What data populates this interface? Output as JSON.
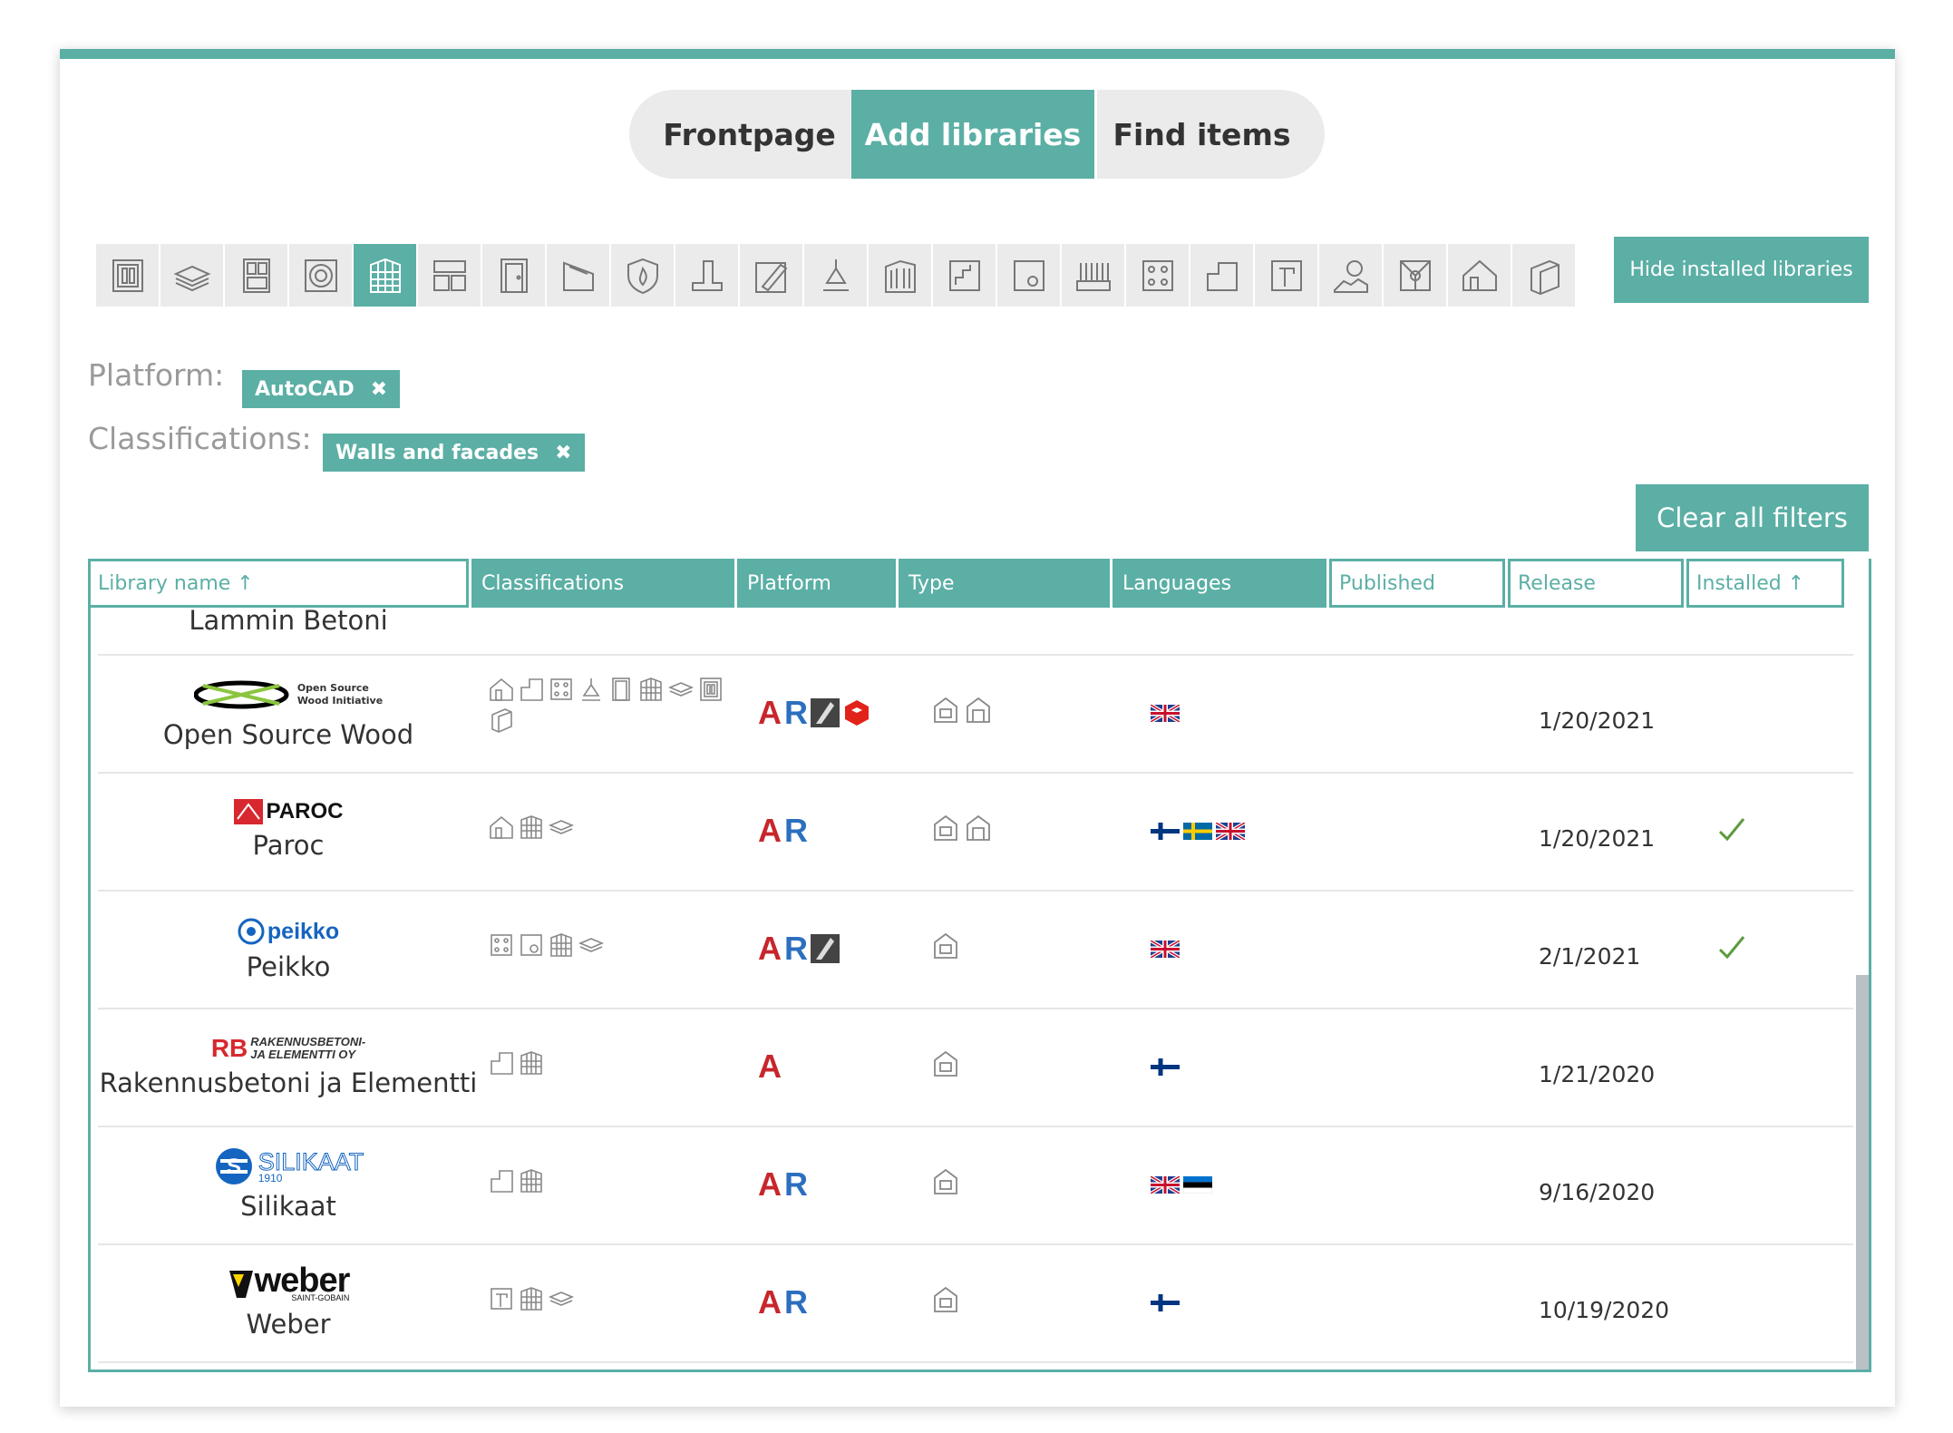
{
  "nav": {
    "tabs": [
      {
        "label": "Frontpage",
        "active": false
      },
      {
        "label": "Add libraries",
        "active": true
      },
      {
        "label": "Find items",
        "active": false
      }
    ]
  },
  "categories": [
    "panel-icon",
    "layers-icon",
    "cabinet-icon",
    "disc-icon",
    "grid-wall-icon",
    "modules-icon",
    "door-icon",
    "roof-icon",
    "fire-icon",
    "chimney-icon",
    "pencil-icon",
    "lamp-icon",
    "facade-icon",
    "stair-icon",
    "socket-icon",
    "fence-icon",
    "dots-panel-icon",
    "step-icon",
    "faucet-icon",
    "landscape-icon",
    "vent-icon",
    "house-icon",
    "sheet-icon"
  ],
  "active_category": 4,
  "buttons": {
    "hide_installed": "Hide installed libraries",
    "clear_filters": "Clear all filters"
  },
  "filters": {
    "platform_label": "Platform:",
    "platform_chip": "AutoCAD",
    "classifications_label": "Classifications:",
    "classifications_chip": "Walls and facades",
    "remove_glyph": "✖"
  },
  "table": {
    "headers": {
      "library_name": "Library name ↑",
      "classifications": "Classifications",
      "platform": "Platform",
      "type": "Type",
      "languages": "Languages",
      "published": "Published",
      "release": "Release",
      "installed": "Installed ↑"
    },
    "rows": [
      {
        "name": "Lammin Betoni",
        "logo": "",
        "release": "",
        "installed": false
      },
      {
        "name": "Open Source Wood",
        "logo": "Open Source Wood Initiative",
        "release": "1/20/2021",
        "installed": false
      },
      {
        "name": "Paroc",
        "logo": "PAROC",
        "release": "1/20/2021",
        "installed": true
      },
      {
        "name": "Peikko",
        "logo": "peikko",
        "release": "2/1/2021",
        "installed": true
      },
      {
        "name": "Rakennusbetoni ja Elementti",
        "logo": "RAKENNUSBETONI- JA ELEMENTTI OY",
        "release": "1/21/2020",
        "installed": false
      },
      {
        "name": "Silikaat",
        "logo": "SILIKAAT 1910",
        "release": "9/16/2020",
        "installed": false
      },
      {
        "name": "Weber",
        "logo": "weber SAINT-GOBAIN",
        "release": "10/19/2020",
        "installed": false
      }
    ],
    "logo_text": {
      "osw_line1": "Open Source",
      "osw_line2": "Wood Initiative",
      "paroc": "PAROC",
      "peikko": "peikko",
      "rb_line1": "RAKENNUSBETONI-",
      "rb_line2": "JA ELEMENTTI OY",
      "silikaat": "SILIKAAT",
      "silikaat_year": "1910",
      "weber": "weber",
      "weber_sub": "SAINT-GOBAIN"
    },
    "platform_letters": {
      "a": "A",
      "r": "R"
    }
  },
  "colors": {
    "accent": "#5bafa5",
    "text": "#333333",
    "muted": "#9a9a9a"
  }
}
